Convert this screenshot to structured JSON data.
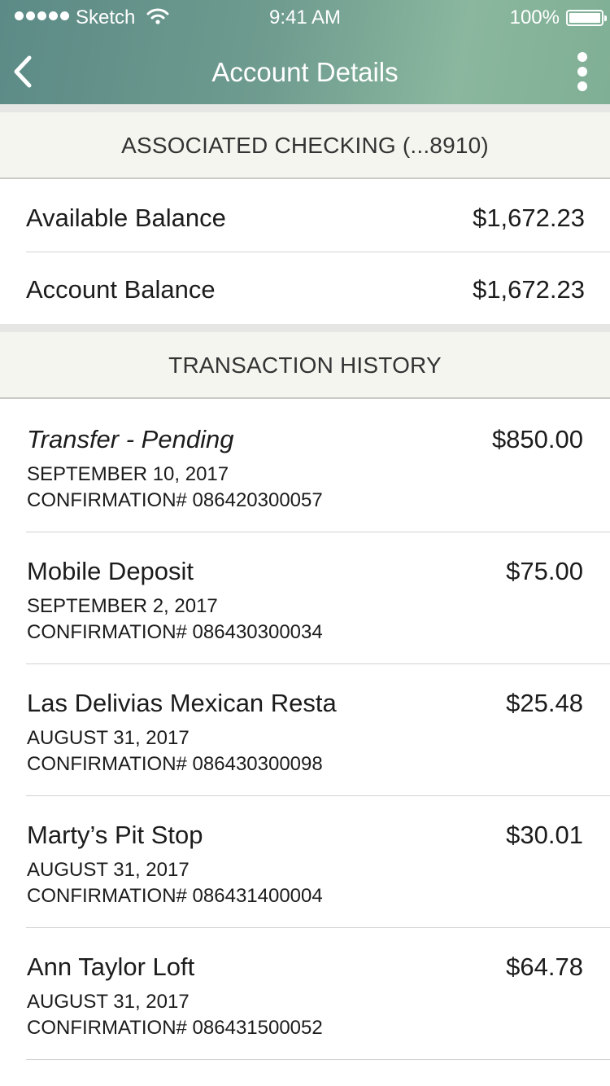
{
  "status_bar": {
    "carrier": "Sketch",
    "time": "9:41 AM",
    "battery": "100%"
  },
  "nav": {
    "title": "Account Details",
    "back_icon": "chevron-left-icon",
    "menu_icon": "more-vertical-icon"
  },
  "account": {
    "header": "ASSOCIATED CHECKING (...8910)",
    "balances": [
      {
        "label": "Available Balance",
        "value": "$1,672.23"
      },
      {
        "label": "Account Balance",
        "value": "$1,672.23"
      }
    ]
  },
  "history": {
    "header": "TRANSACTION HISTORY",
    "transactions": [
      {
        "name": "Transfer - Pending",
        "amount": "$850.00",
        "date": "SEPTEMBER 10, 2017",
        "confirmation": "CONFIRMATION# 086420300057",
        "pending": true
      },
      {
        "name": "Mobile Deposit",
        "amount": "$75.00",
        "date": "SEPTEMBER 2, 2017",
        "confirmation": "CONFIRMATION# 086430300034",
        "pending": false
      },
      {
        "name": "Las Delivias Mexican Resta",
        "amount": "$25.48",
        "date": "AUGUST 31, 2017",
        "confirmation": "CONFIRMATION# 086430300098",
        "pending": false
      },
      {
        "name": "Marty’s Pit Stop",
        "amount": "$30.01",
        "date": "AUGUST 31, 2017",
        "confirmation": "CONFIRMATION# 086431400004",
        "pending": false
      },
      {
        "name": "Ann Taylor Loft",
        "amount": "$64.78",
        "date": "AUGUST 31, 2017",
        "confirmation": "CONFIRMATION# 086431500052",
        "pending": false
      }
    ]
  },
  "colors": {
    "header_gradient_start": "#5c8a86",
    "header_gradient_end": "#8ab79e",
    "section_background": "#f5f5f0",
    "text": "#1c1c1c"
  }
}
